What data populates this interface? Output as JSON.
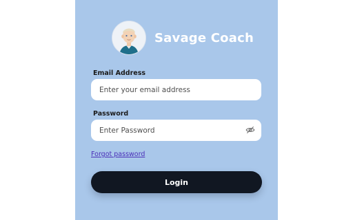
{
  "brand": {
    "title": "Savage Coach"
  },
  "form": {
    "email": {
      "label": "Email Address",
      "placeholder": "Enter your email address",
      "value": ""
    },
    "password": {
      "label": "Password",
      "placeholder": "Enter Password",
      "value": "",
      "toggle_icon": "eye-off-icon"
    },
    "forgot_link": "Forgot password",
    "login_label": "Login"
  },
  "colors": {
    "panel": "#a9c7ea",
    "button": "#111722",
    "link": "#4a2fb8",
    "input_bg": "#ffffff"
  }
}
